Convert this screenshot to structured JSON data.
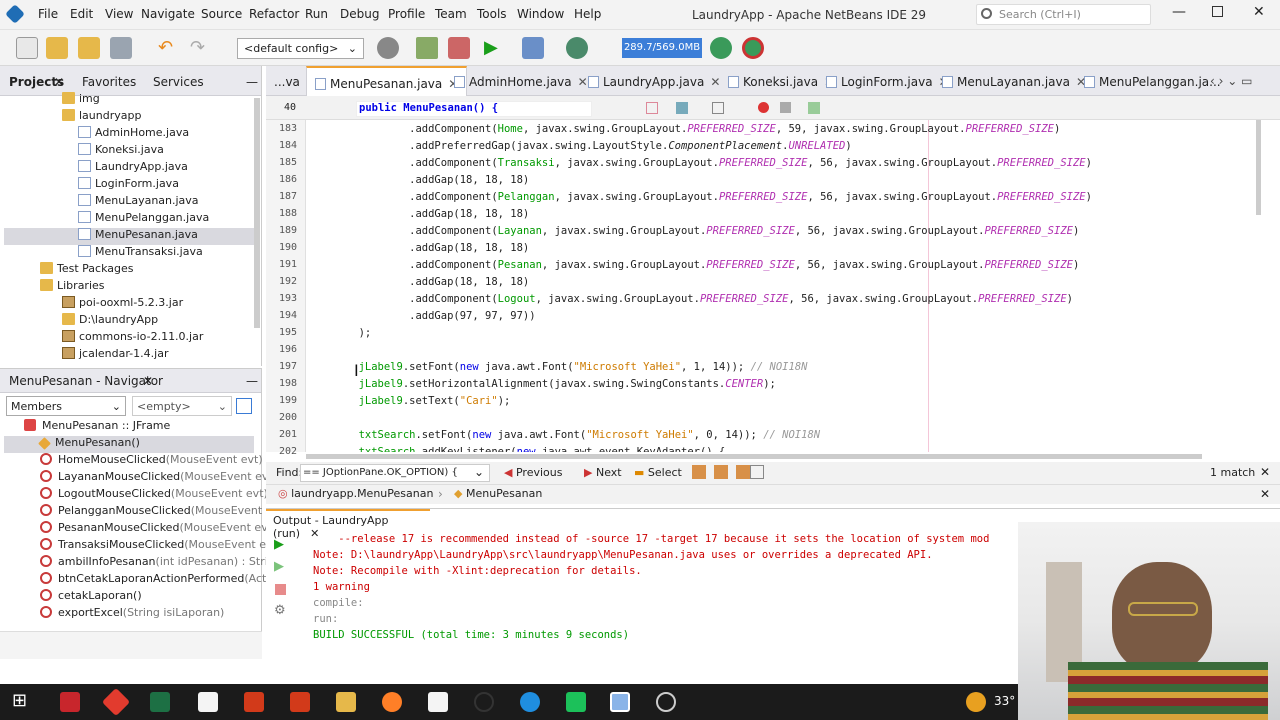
{
  "menu": [
    "File",
    "Edit",
    "View",
    "Navigate",
    "Source",
    "Refactor",
    "Run",
    "Debug",
    "Profile",
    "Team",
    "Tools",
    "Window",
    "Help"
  ],
  "window_title": "LaundryApp - Apache NetBeans IDE 29",
  "search_placeholder": "Search (Ctrl+I)",
  "toolbar": {
    "config": "<default config>",
    "memory": "289.7/569.0MB"
  },
  "projects_tabs": [
    "Projects",
    "Favorites",
    "Services"
  ],
  "project_tree": [
    {
      "label": "img",
      "type": "folder"
    },
    {
      "label": "laundryapp",
      "type": "folder"
    },
    {
      "label": "AdminHome.java",
      "type": "java"
    },
    {
      "label": "Koneksi.java",
      "type": "java"
    },
    {
      "label": "LaundryApp.java",
      "type": "java"
    },
    {
      "label": "LoginForm.java",
      "type": "java"
    },
    {
      "label": "MenuLayanan.java",
      "type": "java"
    },
    {
      "label": "MenuPelanggan.java",
      "type": "java"
    },
    {
      "label": "MenuPesanan.java",
      "type": "java",
      "selected": true
    },
    {
      "label": "MenuTransaksi.java",
      "type": "java"
    },
    {
      "label": "Test Packages",
      "type": "folder"
    },
    {
      "label": "Libraries",
      "type": "folder"
    },
    {
      "label": "poi-ooxml-5.2.3.jar",
      "type": "jar"
    },
    {
      "label": "D:\\laundryApp",
      "type": "folder"
    },
    {
      "label": "commons-io-2.11.0.jar",
      "type": "jar"
    },
    {
      "label": "jcalendar-1.4.jar",
      "type": "jar"
    }
  ],
  "navigator": {
    "title": "MenuPesanan - Navigator",
    "members_label": "Members",
    "filter_value": "<empty>",
    "root": "MenuPesanan :: JFrame",
    "items": [
      {
        "name": "MenuPesanan()",
        "sig": ""
      },
      {
        "name": "HomeMouseClicked",
        "sig": "(MouseEvent evt)"
      },
      {
        "name": "LayananMouseClicked",
        "sig": "(MouseEvent ev"
      },
      {
        "name": "LogoutMouseClicked",
        "sig": "(MouseEvent evt)"
      },
      {
        "name": "PelangganMouseClicked",
        "sig": "(MouseEvent"
      },
      {
        "name": "PesananMouseClicked",
        "sig": "(MouseEvent ev"
      },
      {
        "name": "TransaksiMouseClicked",
        "sig": "(MouseEvent e"
      },
      {
        "name": "ambilInfoPesanan",
        "sig": "(int idPesanan) : Strir"
      },
      {
        "name": "btnCetakLaporanActionPerformed",
        "sig": "(Act"
      },
      {
        "name": "cetakLaporan()",
        "sig": ""
      },
      {
        "name": "exportExcel",
        "sig": "(String isiLaporan)"
      }
    ]
  },
  "editor_tabs": [
    "...va",
    "MenuPesanan.java",
    "AdminHome.java",
    "LaundryApp.java",
    "Koneksi.java",
    "LoginForm.java",
    "MenuLayanan.java",
    "MenuPelanggan.ja..."
  ],
  "sticky_line": {
    "num": "40",
    "text": "public MenuPesanan() {"
  },
  "code_lines": [
    {
      "n": "183",
      "c": "                .addComponent(Home, javax.swing.GroupLayout.PREFERRED_SIZE, 59, javax.swing.GroupLayout.PREFERRED_SIZE)"
    },
    {
      "n": "184",
      "c": "                .addPreferredGap(javax.swing.LayoutStyle.ComponentPlacement.UNRELATED)"
    },
    {
      "n": "185",
      "c": "                .addComponent(Transaksi, javax.swing.GroupLayout.PREFERRED_SIZE, 56, javax.swing.GroupLayout.PREFERRED_SIZE)"
    },
    {
      "n": "186",
      "c": "                .addGap(18, 18, 18)"
    },
    {
      "n": "187",
      "c": "                .addComponent(Pelanggan, javax.swing.GroupLayout.PREFERRED_SIZE, 56, javax.swing.GroupLayout.PREFERRED_SIZE)"
    },
    {
      "n": "188",
      "c": "                .addGap(18, 18, 18)"
    },
    {
      "n": "189",
      "c": "                .addComponent(Layanan, javax.swing.GroupLayout.PREFERRED_SIZE, 56, javax.swing.GroupLayout.PREFERRED_SIZE)"
    },
    {
      "n": "190",
      "c": "                .addGap(18, 18, 18)"
    },
    {
      "n": "191",
      "c": "                .addComponent(Pesanan, javax.swing.GroupLayout.PREFERRED_SIZE, 56, javax.swing.GroupLayout.PREFERRED_SIZE)"
    },
    {
      "n": "192",
      "c": "                .addGap(18, 18, 18)"
    },
    {
      "n": "193",
      "c": "                .addComponent(Logout, javax.swing.GroupLayout.PREFERRED_SIZE, 56, javax.swing.GroupLayout.PREFERRED_SIZE)"
    },
    {
      "n": "194",
      "c": "                .addGap(97, 97, 97))"
    },
    {
      "n": "195",
      "c": "        );"
    },
    {
      "n": "196",
      "c": ""
    },
    {
      "n": "197",
      "c": "        jLabel9.setFont(new java.awt.Font(\"Microsoft YaHei\", 1, 14)); // NOI18N"
    },
    {
      "n": "198",
      "c": "        jLabel9.setHorizontalAlignment(javax.swing.SwingConstants.CENTER);"
    },
    {
      "n": "199",
      "c": "        jLabel9.setText(\"Cari\");"
    },
    {
      "n": "200",
      "c": ""
    },
    {
      "n": "201",
      "c": "        txtSearch.setFont(new java.awt.Font(\"Microsoft YaHei\", 0, 14)); // NOI18N"
    },
    {
      "n": "202",
      "c": "        txtSearch.addKeyListener(new java.awt.event.KeyAdapter() {"
    }
  ],
  "find": {
    "label": "Find:",
    "value": "== JOptionPane.OK_OPTION) {",
    "previous": "Previous",
    "next": "Next",
    "select": "Select",
    "matches": "1 match"
  },
  "breadcrumb": [
    "laundryapp.MenuPesanan",
    "MenuPesanan"
  ],
  "output": {
    "title": "Output - LaundryApp (run)",
    "lines": [
      {
        "t": "    --release 17 is recommended instead of -source 17 -target 17 because it sets the location of system mod",
        "c": "#cc0000"
      },
      {
        "t": "Note: D:\\laundryApp\\LaundryApp\\src\\laundryapp\\MenuPesanan.java uses or overrides a deprecated API.",
        "c": "#cc0000"
      },
      {
        "t": "Note: Recompile with -Xlint:deprecation for details.",
        "c": "#cc0000"
      },
      {
        "t": "1 warning",
        "c": "#cc0000"
      },
      {
        "t": "compile:",
        "c": "#888888"
      },
      {
        "t": "run:",
        "c": "#888888"
      },
      {
        "t": "BUILD SUCCESSFUL (total time: 3 minutes 9 seconds)",
        "c": "#009900"
      }
    ]
  },
  "taskbar": {
    "temp": "33°"
  }
}
